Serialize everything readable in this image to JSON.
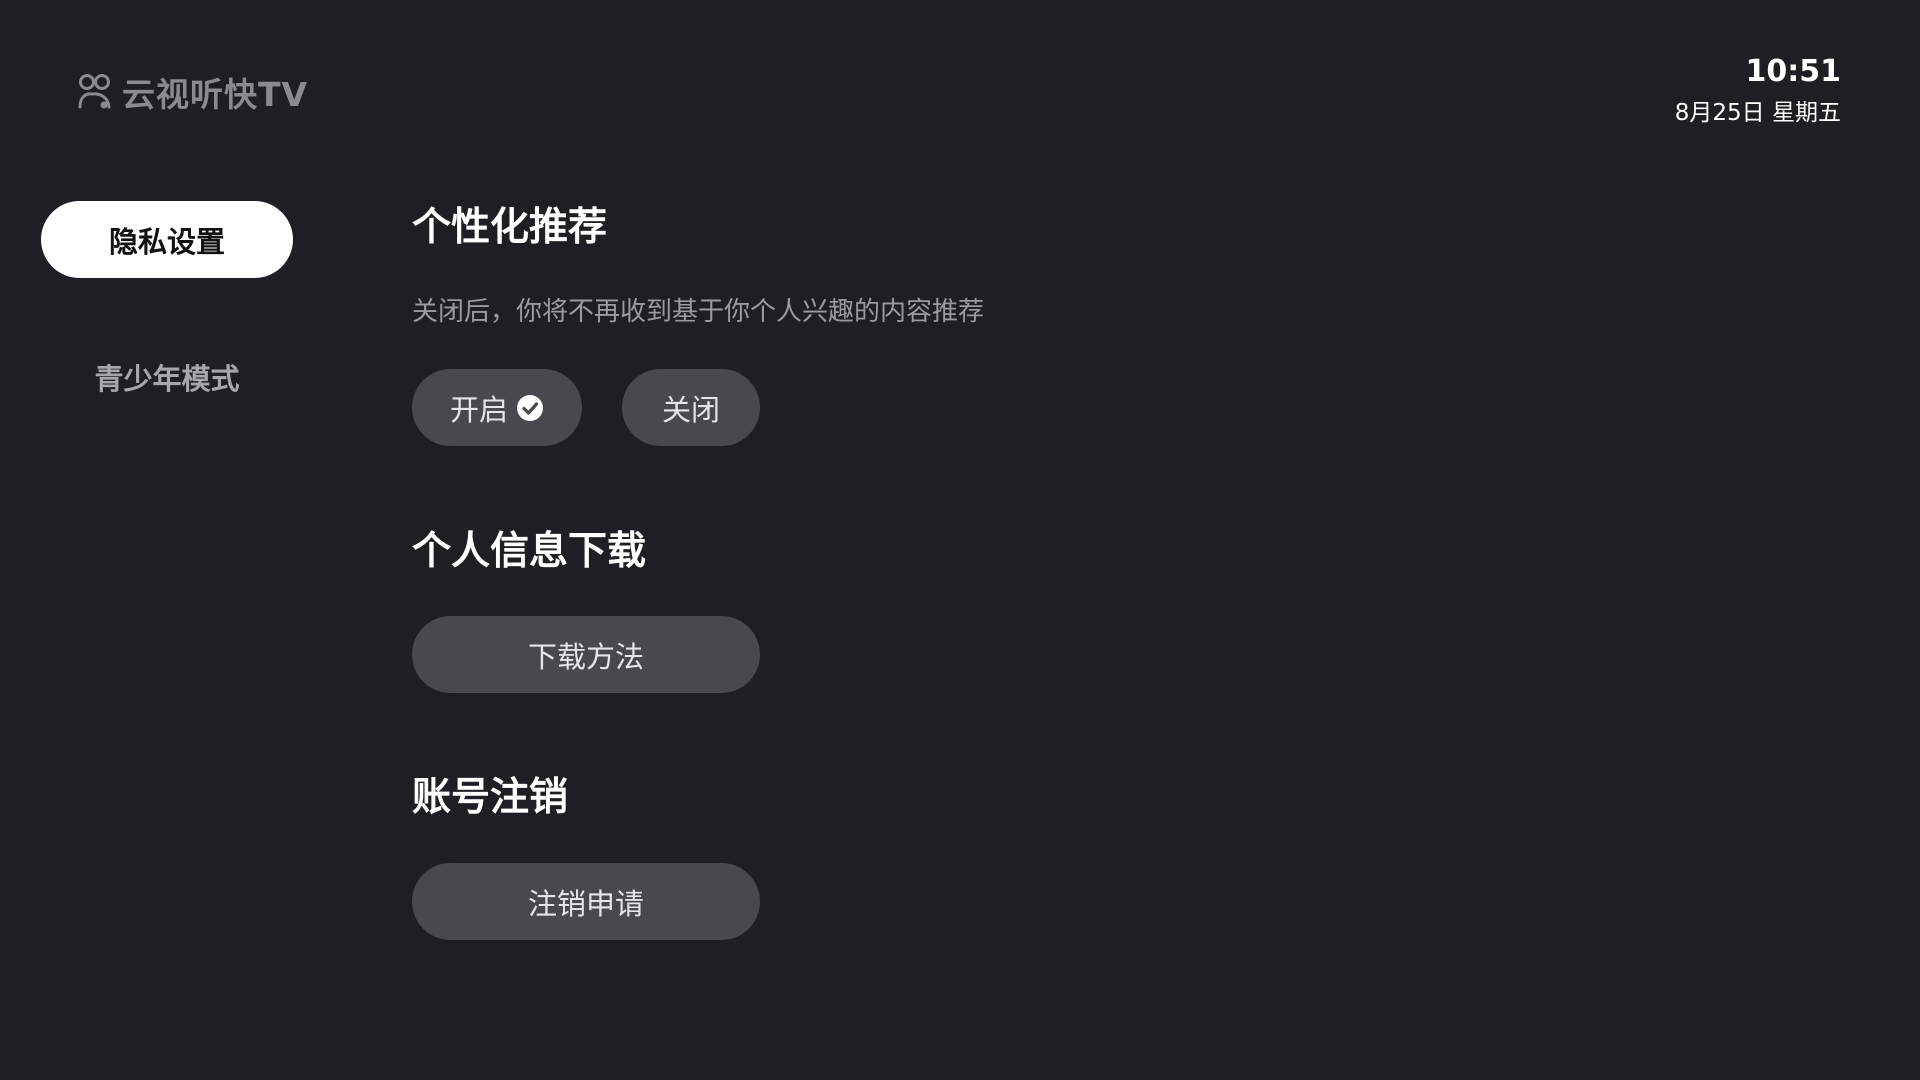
{
  "header": {
    "app_name": "云视听快TV",
    "logo_icon": "people-icon",
    "time": "10:51",
    "date": "8月25日 星期五"
  },
  "sidebar": {
    "items": [
      {
        "label": "隐私设置",
        "active": true
      },
      {
        "label": "青少年模式",
        "active": false
      }
    ]
  },
  "main": {
    "personalized": {
      "title": "个性化推荐",
      "description": "关闭后，你将不再收到基于你个人兴趣的内容推荐",
      "on_label": "开启",
      "off_label": "关闭",
      "selected": "开启",
      "check_icon": "check-circle-icon"
    },
    "download": {
      "title": "个人信息下载",
      "button_label": "下载方法"
    },
    "account": {
      "title": "账号注销",
      "button_label": "注销申请"
    }
  },
  "colors": {
    "background": "#1e1f24",
    "pill": "#48484e",
    "active_tab": "#ffffff",
    "muted_text": "#9a9ba0"
  }
}
